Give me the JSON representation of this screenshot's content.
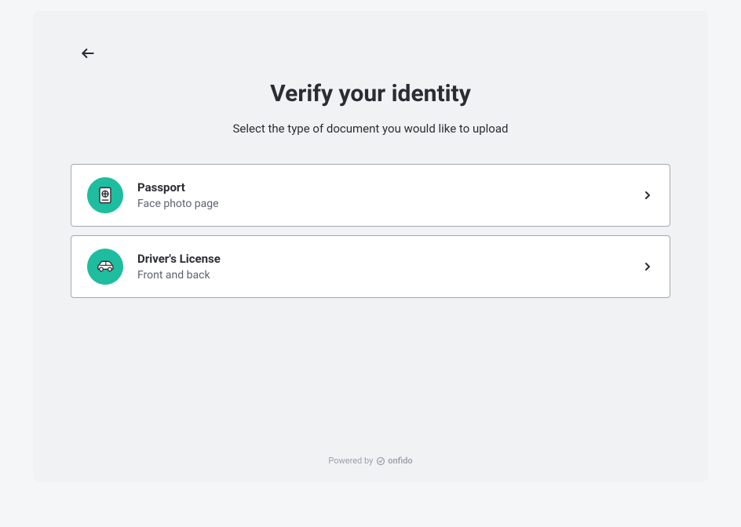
{
  "header": {
    "title": "Verify your identity",
    "subtitle": "Select the type of document you would like to upload"
  },
  "options": [
    {
      "id": "passport",
      "title": "Passport",
      "description": "Face photo page",
      "icon": "passport-icon"
    },
    {
      "id": "drivers_license",
      "title": "Driver's License",
      "description": "Front and back",
      "icon": "car-icon"
    }
  ],
  "footer": {
    "powered_by": "Powered by",
    "brand": "onfido"
  },
  "colors": {
    "accent": "#1fbd9f",
    "text_primary": "#2b2d33",
    "text_secondary": "#5c6370",
    "border": "#a2a8b3",
    "background": "#f1f2f3"
  }
}
